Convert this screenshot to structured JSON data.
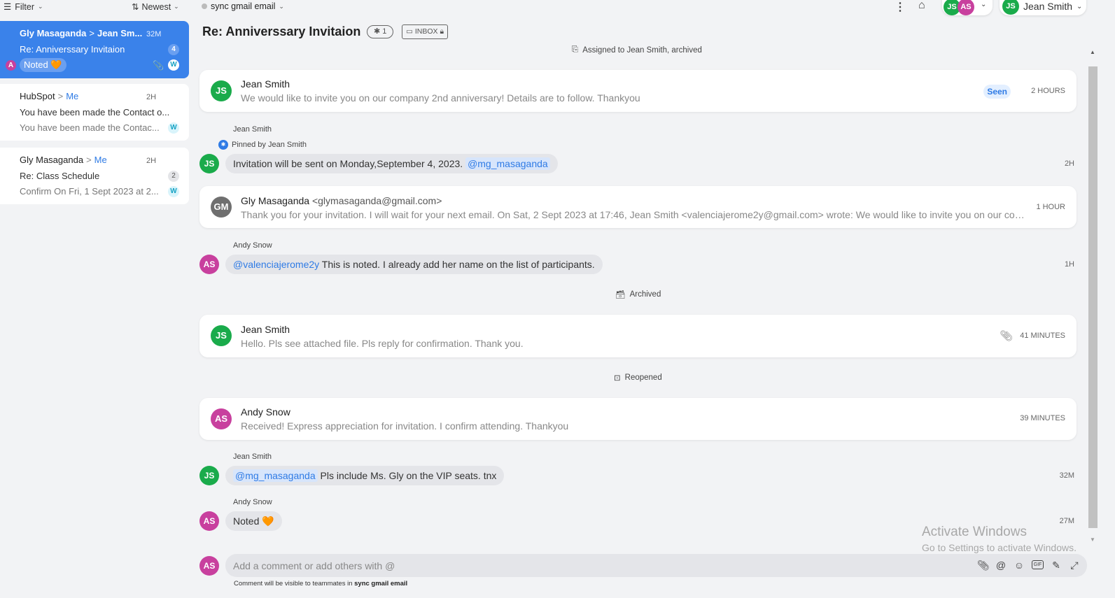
{
  "sidebar": {
    "filter_label": "Filter",
    "sort_label": "Newest",
    "conversations": [
      {
        "from": "Gly Masaganda",
        "to": "Jean Sm...",
        "time": "32M",
        "subject": "Re: Anniverssary Invitaion",
        "count": "4",
        "tag": "Noted 🧡",
        "assignee_initial": "A",
        "workspace_badge": "W",
        "active": true
      },
      {
        "from": "HubSpot",
        "to": "Me",
        "time": "2H",
        "subject": "You have been made the Contact o...",
        "preview": "You have been made the Contac...",
        "workspace_badge": "W"
      },
      {
        "from": "Gly Masaganda",
        "to": "Me",
        "time": "2H",
        "subject": "Re: Class Schedule",
        "count": "2",
        "preview": "Confirm On Fri, 1 Sept 2023 at 2...",
        "workspace_badge": "W"
      }
    ]
  },
  "header": {
    "account": "sync gmail email",
    "title": "Re: Anniverssary Invitaion",
    "pin_count": "1",
    "inbox_label": "INBOX",
    "participants": [
      "JS",
      "AS"
    ],
    "current_user": {
      "initials": "JS",
      "name": "Jean Smith"
    }
  },
  "thread": {
    "assigned_event": "Assigned to Jean Smith, archived",
    "messages": [
      {
        "type": "email",
        "initials": "JS",
        "name": "Jean Smith",
        "preview": "We would like to invite you on our company 2nd anniversary! Details are to follow. Thankyou",
        "status": "Seen",
        "time": "2 HOURS"
      },
      {
        "type": "comment",
        "author": "Jean Smith",
        "pinned_by": "Pinned by Jean Smith",
        "initials": "JS",
        "text": "Invitation will be sent on Monday,September 4, 2023.",
        "mention": "@mg_masaganda",
        "time": "2H"
      },
      {
        "type": "email",
        "initials": "GM",
        "name": "Gly Masaganda",
        "email": "<glymasaganda@gmail.com>",
        "preview": "Thank you for your invitation. I will wait for your next email. On Sat, 2 Sept 2023 at 17:46, Jean Smith <valenciajerome2y@gmail.com> wrote: We would like to invite you on our compa...",
        "time": "1 HOUR"
      },
      {
        "type": "comment",
        "author": "Andy Snow",
        "initials": "AS",
        "mention": "@valenciajerome2y",
        "text": "This is noted. I already add her name on the list of participants.",
        "time": "1H"
      },
      {
        "type": "event",
        "text": "Archived"
      },
      {
        "type": "email",
        "initials": "JS",
        "name": "Jean Smith",
        "preview": "Hello. Pls see attached file. Pls reply for confirmation. Thank you.",
        "has_attachment": true,
        "time": "41 MINUTES"
      },
      {
        "type": "event",
        "text": "Reopened"
      },
      {
        "type": "email",
        "initials": "AS",
        "name": "Andy Snow",
        "preview": "Received! Express appreciation for invitation. I confirm attending. Thankyou",
        "time": "39 MINUTES"
      },
      {
        "type": "comment",
        "author": "Jean Smith",
        "initials": "JS",
        "mention": "@mg_masaganda",
        "text": "Pls include Ms. Gly on the VIP seats. tnx",
        "time": "32M"
      },
      {
        "type": "comment",
        "author": "Andy Snow",
        "initials": "AS",
        "text": "Noted 🧡",
        "time": "27M"
      }
    ]
  },
  "composer": {
    "initials": "AS",
    "placeholder": "Add a comment or add others with @",
    "hint_prefix": "Comment will be visible to teammates in",
    "hint_account": "sync gmail email",
    "tools": [
      "attach-icon",
      "mention-icon",
      "emoji-icon",
      "gif-icon",
      "ai-wand-icon",
      "expand-icon"
    ]
  },
  "watermark": {
    "line1": "Activate Windows",
    "line2": "Go to Settings to activate Windows."
  },
  "colors": {
    "accent": "#3a82ea",
    "js_avatar": "#1aab4b",
    "as_avatar": "#c8409e",
    "gm_avatar": "#6f6f6f"
  }
}
